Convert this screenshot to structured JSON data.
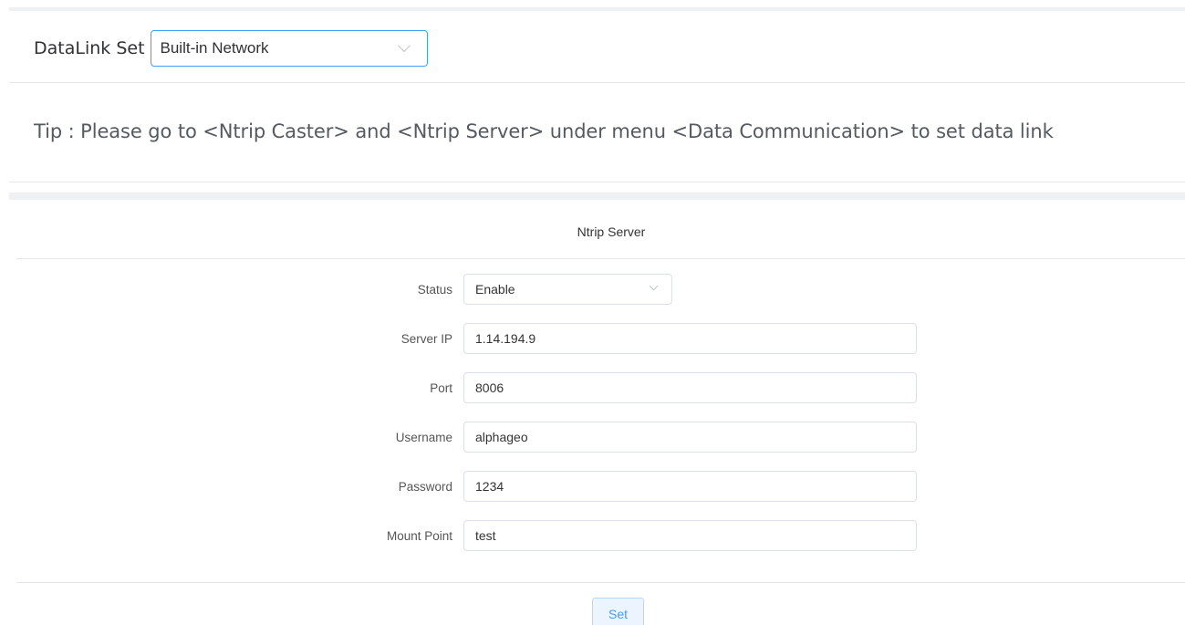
{
  "datalink": {
    "label": "DataLink Set",
    "selected": "Built-in Network"
  },
  "tip": "Tip : Please go to <Ntrip Caster> and <Ntrip Server> under menu <Data Communication> to set data link",
  "ntrip_server": {
    "title": "Ntrip Server",
    "fields": [
      {
        "label": "Status",
        "value": "Enable"
      },
      {
        "label": "Server IP",
        "value": "1.14.194.9"
      },
      {
        "label": "Port",
        "value": "8006"
      },
      {
        "label": "Username",
        "value": "alphageo"
      },
      {
        "label": "Password",
        "value": "1234"
      },
      {
        "label": "Mount Point",
        "value": "test"
      }
    ],
    "set_label": "Set"
  },
  "icons": {
    "dropdown": "chevron-down-icon"
  },
  "colors": {
    "accent": "#409eff",
    "button_bg": "#ecf5ff",
    "border": "#dcdfe6"
  }
}
